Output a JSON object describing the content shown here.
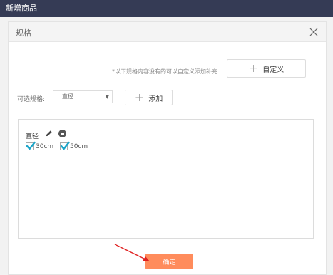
{
  "topbar": {
    "title": "新增商品"
  },
  "modal": {
    "title": "规格",
    "hint": "*以下规格内容没有的可以自定义添加补充",
    "custom_button": "自定义",
    "select_label": "可选规格:",
    "select_value": "直径",
    "add_button": "添加",
    "spec": {
      "name": "直径",
      "options": [
        {
          "label": "30cm",
          "checked": true
        },
        {
          "label": "50cm",
          "checked": true
        }
      ]
    },
    "confirm_button": "确定"
  },
  "colors": {
    "topbar_bg": "#353b55",
    "confirm_bg": "#ff8c5c",
    "checkbox_check": "#1aa5c9",
    "annotation_arrow": "#e02020"
  }
}
